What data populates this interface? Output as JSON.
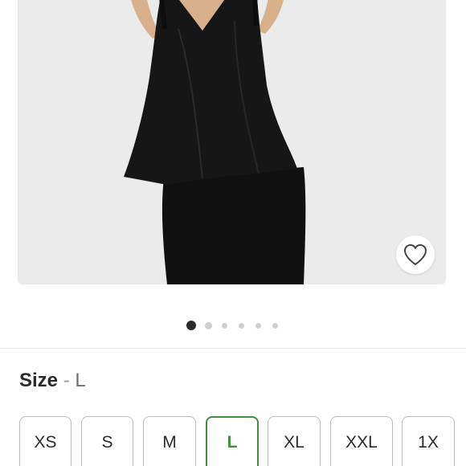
{
  "product": {
    "image_alt": "Black sleeveless satin top and black skirt",
    "favorite_icon": "heart-outline-icon"
  },
  "carousel": {
    "total": 6,
    "active_index": 0
  },
  "size_selector": {
    "title": "Size",
    "separator": "-",
    "selected_value": "L",
    "options": [
      {
        "label": "XS",
        "selected": false
      },
      {
        "label": "S",
        "selected": false
      },
      {
        "label": "M",
        "selected": false
      },
      {
        "label": "L",
        "selected": true
      },
      {
        "label": "XL",
        "selected": false
      },
      {
        "label": "XXL",
        "selected": false
      },
      {
        "label": "1X",
        "selected": false
      }
    ]
  },
  "colors": {
    "accent_selected": "#3e8f3e",
    "background_image": "#ebebeb",
    "garment": "#141414"
  }
}
